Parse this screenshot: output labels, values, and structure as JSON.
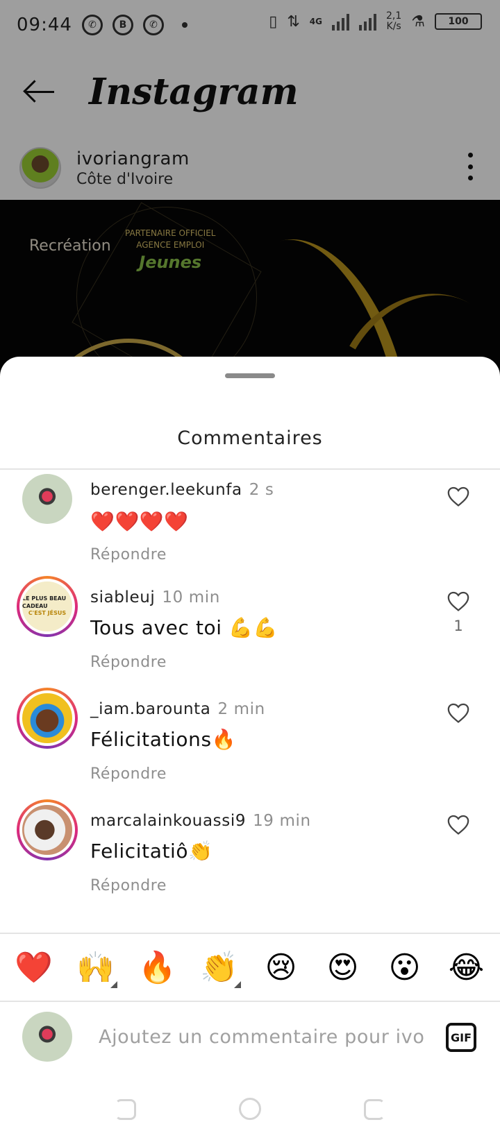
{
  "status_bar": {
    "time": "09:44",
    "net_type": "4G",
    "speed": "2,1",
    "speed_unit": "K/s",
    "battery": "100"
  },
  "app_bar": {
    "title": "Instagram"
  },
  "post_header": {
    "username": "ivoriangram",
    "location": "Côte d'Ivoire"
  },
  "post_image": {
    "brand_text": "Recréation",
    "partner_line1": "PARTENAIRE OFFICIEL",
    "partner_line2": "AGENCE EMPLOI",
    "partner_brand": "Jeunes"
  },
  "sheet": {
    "title": "Commentaires"
  },
  "comments": [
    {
      "username": "berenger.leekunfa",
      "time": "2 s",
      "text": "❤️❤️❤️❤️",
      "reply": "Répondre",
      "likes": ""
    },
    {
      "username": "siableuj",
      "time": "10 min",
      "text": "Tous avec toi 💪💪",
      "reply": "Répondre",
      "likes": "1"
    },
    {
      "username": "_iam.barounta",
      "time": "2 min",
      "text": "Félicitations🔥",
      "reply": "Répondre",
      "likes": ""
    },
    {
      "username": "marcalainkouassi9",
      "time": "19 min",
      "text": "Felicitatiô👏",
      "reply": "Répondre",
      "likes": ""
    }
  ],
  "avatar2_text": {
    "l1": "LE PLUS BEAU CADEAU",
    "l2": "C'EST JÉSUS"
  },
  "emoji_bar": [
    "❤️",
    "🙌",
    "🔥",
    "👏",
    "😢",
    "😍",
    "😮",
    "😂"
  ],
  "composer": {
    "placeholder": "Ajoutez un commentaire pour ivorian",
    "gif_label": "GIF"
  },
  "colors": {
    "story_ring_start": "#f58529",
    "story_ring_mid": "#dd2a7b",
    "secondary_text": "#8e8e8e"
  }
}
